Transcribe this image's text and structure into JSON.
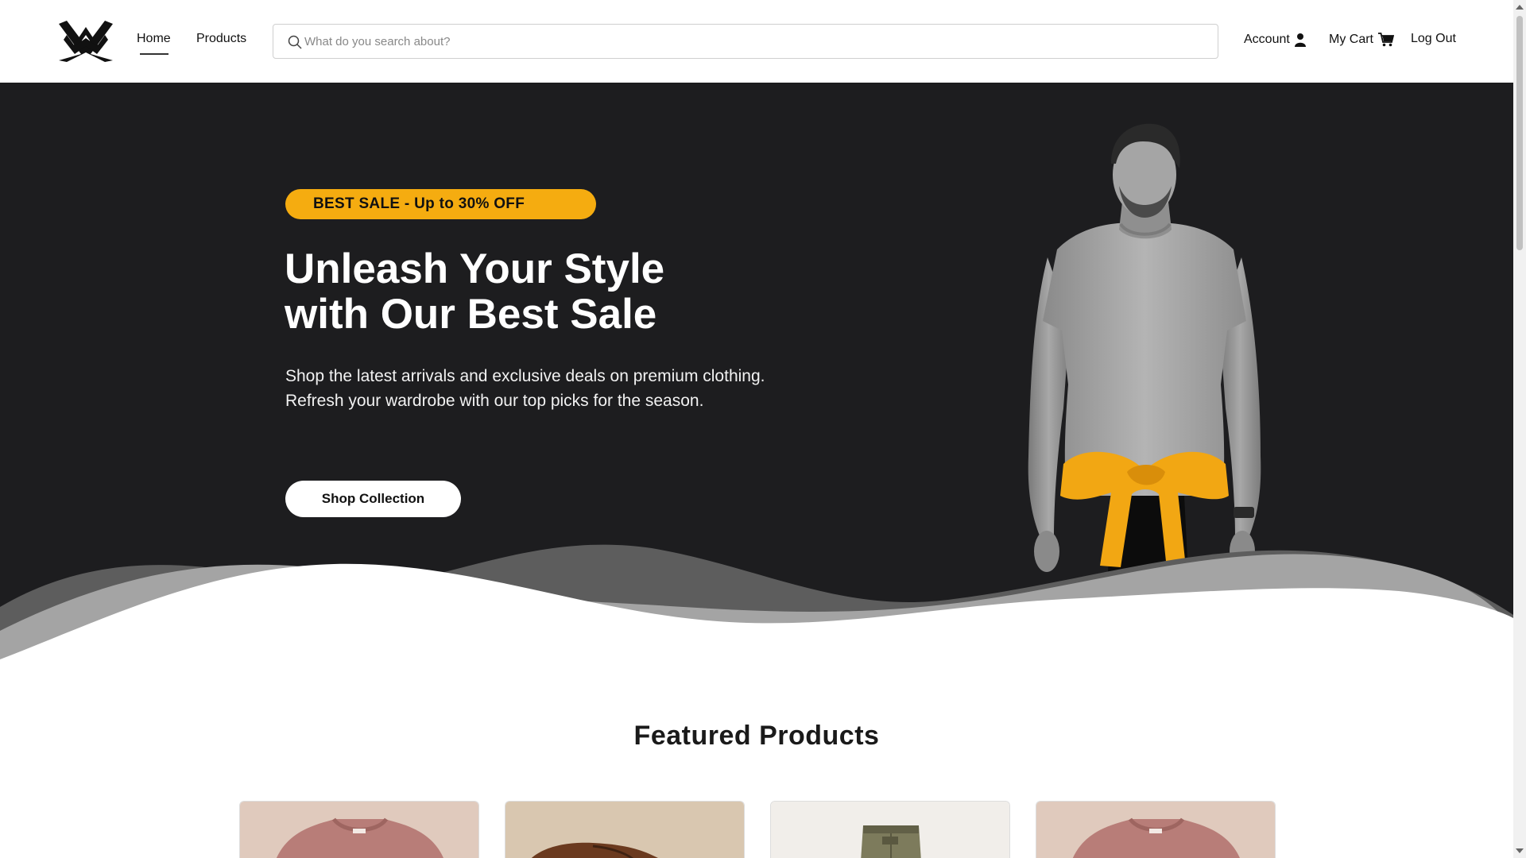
{
  "header": {
    "nav": [
      {
        "label": "Home",
        "active": true
      },
      {
        "label": "Products",
        "active": false
      }
    ],
    "search": {
      "placeholder": "What do you search about?",
      "value": ""
    },
    "account_label": "Account",
    "cart_label": "My Cart",
    "logout_label": "Log Out"
  },
  "hero": {
    "badge": "BEST SALE - Up to 30% OFF",
    "title_line1": "Unleash Your Style",
    "title_line2": "with Our Best Sale",
    "subtitle_line1": "Shop the latest arrivals and exclusive deals on premium clothing.",
    "subtitle_line2": "Refresh your wardrobe with our top picks for the season.",
    "cta_label": "Shop Collection",
    "colors": {
      "background": "#1d1d1f",
      "accent": "#f5ac10"
    }
  },
  "featured": {
    "title": "Featured Products",
    "products": [
      {
        "image": "sweater"
      },
      {
        "image": "leather-shoe"
      },
      {
        "image": "cargo-pants"
      },
      {
        "image": "sweater"
      }
    ]
  }
}
